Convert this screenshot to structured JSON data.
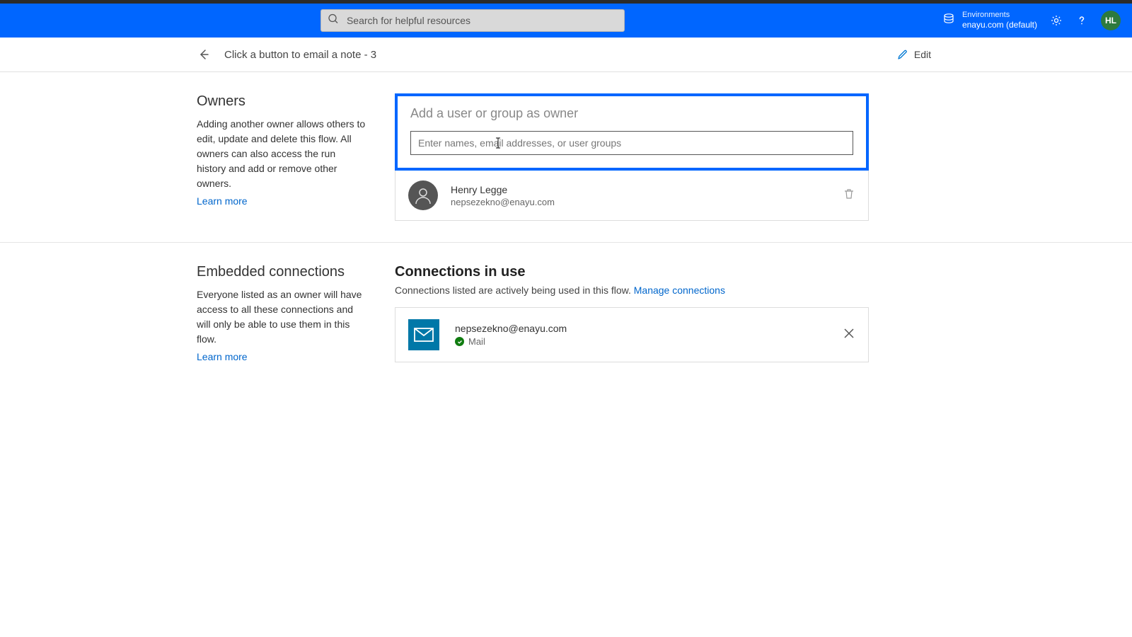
{
  "topbar": {
    "search_placeholder": "Search for helpful resources",
    "env_label": "Environments",
    "env_name": "enayu.com (default)",
    "avatar_initials": "HL"
  },
  "subheader": {
    "title": "Click a button to email a note - 3",
    "edit_label": "Edit"
  },
  "owners_section": {
    "heading": "Owners",
    "description": "Adding another owner allows others to edit, update and delete this flow. All owners can also access the run history and add or remove other owners.",
    "learn_more": "Learn more",
    "add_title": "Add a user or group as owner",
    "input_placeholder": "Enter names, email addresses, or user groups",
    "owner": {
      "name": "Henry Legge",
      "email": "nepsezekno@enayu.com"
    }
  },
  "connections_section": {
    "heading": "Embedded connections",
    "description": "Everyone listed as an owner will have access to all these connections and will only be able to use them in this flow.",
    "learn_more": "Learn more",
    "title": "Connections in use",
    "subtitle_prefix": "Connections listed are actively being used in this flow. ",
    "manage_link": "Manage connections",
    "connection": {
      "email": "nepsezekno@enayu.com",
      "type": "Mail"
    }
  }
}
